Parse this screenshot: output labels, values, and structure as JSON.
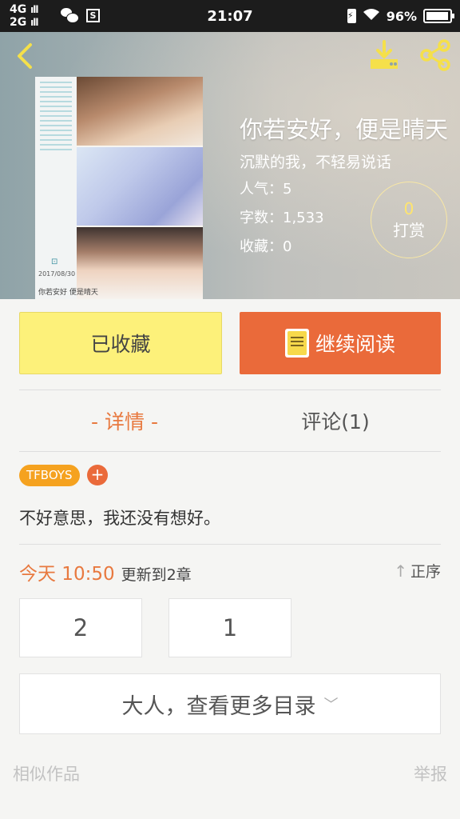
{
  "status_bar": {
    "network_top": "4G",
    "network_bottom": "2G",
    "signal_bars": "ıll",
    "sim_icon_letter": "S",
    "time": "21:07",
    "battery_percent": "96%"
  },
  "header": {
    "back_icon": "chevron-left-icon",
    "download_icon": "download-icon",
    "share_icon": "share-icon"
  },
  "cover": {
    "date_text": "2017/08/30",
    "caption": "你若安好 便是晴天"
  },
  "book": {
    "title": "你若安好，便是晴天",
    "author": "沉默的我，不轻易说话",
    "popularity": "人气：5",
    "word_count": "字数：1,533",
    "favorites": "收藏：0"
  },
  "reward": {
    "count": "0",
    "label": "打赏"
  },
  "actions": {
    "collect_label": "已收藏",
    "read_label": "继续阅读"
  },
  "tabs": {
    "detail": "- 详情 -",
    "comments": "评论(1)"
  },
  "tag": {
    "name": "TFBOYS",
    "add_symbol": "+"
  },
  "description": "不好意思，我还没有想好。",
  "update": {
    "time": "今天 10:50",
    "text": "更新到2章",
    "sort_label": "正序"
  },
  "chapters": [
    "2",
    "1"
  ],
  "more_catalog": "大人，查看更多目录",
  "footer": {
    "similar": "相似作品",
    "report": "举报"
  },
  "colors": {
    "accent_orange": "#ea6a3a",
    "tab_active": "#e8793f",
    "collect_yellow": "#fdf17a",
    "tag_orange": "#f5a21f"
  }
}
